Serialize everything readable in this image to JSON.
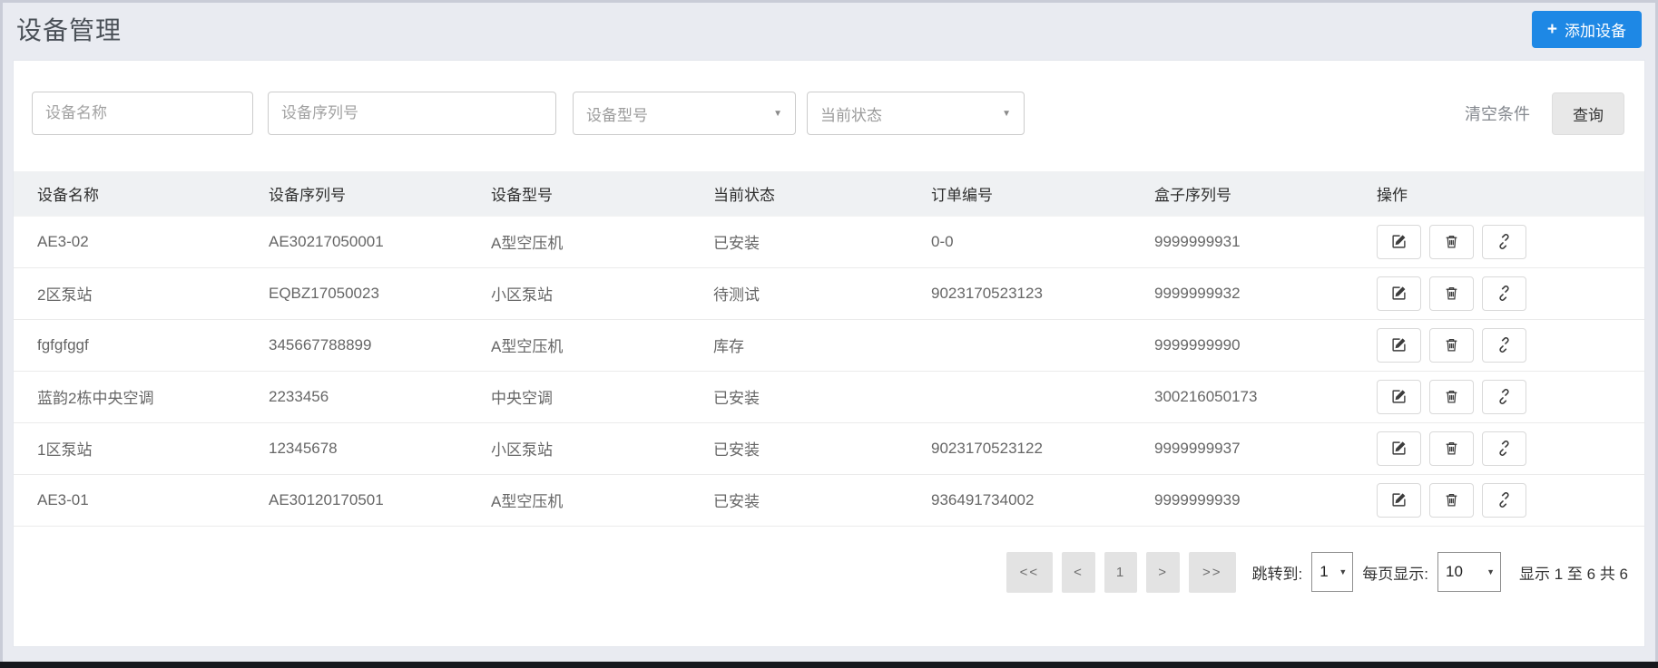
{
  "page": {
    "title": "设备管理"
  },
  "header": {
    "add_button": {
      "plus": "+",
      "label": "添加设备",
      "color": "#1e88e5"
    }
  },
  "filters": {
    "device_name_placeholder": "设备名称",
    "serial_placeholder": "设备序列号",
    "model_selected": "设备型号",
    "status_selected": "当前状态",
    "caret": "▼",
    "clear_label": "清空条件",
    "search_label": "查询"
  },
  "table": {
    "columns": {
      "name": "设备名称",
      "serial": "设备序列号",
      "model": "设备型号",
      "status": "当前状态",
      "order": "订单编号",
      "box": "盒子序列号",
      "actions": "操作"
    },
    "action_icons": [
      "edit-icon",
      "trash-icon",
      "unlink-icon"
    ],
    "rows": [
      {
        "name": "AE3-02",
        "serial": "AE30217050001",
        "model": "A型空压机",
        "status": "已安装",
        "order": "0-0",
        "box": "9999999931"
      },
      {
        "name": "2区泵站",
        "serial": "EQBZ17050023",
        "model": "小区泵站",
        "status": "待测试",
        "order": "9023170523123",
        "box": "9999999932"
      },
      {
        "name": "fgfgfggf",
        "serial": "345667788899",
        "model": "A型空压机",
        "status": "库存",
        "order": "",
        "box": "9999999990"
      },
      {
        "name": "蓝韵2栋中央空调",
        "serial": "2233456",
        "model": "中央空调",
        "status": "已安装",
        "order": "",
        "box": "300216050173"
      },
      {
        "name": "1区泵站",
        "serial": "12345678",
        "model": "小区泵站",
        "status": "已安装",
        "order": "9023170523122",
        "box": "9999999937"
      },
      {
        "name": "AE3-01",
        "serial": "AE30120170501",
        "model": "A型空压机",
        "status": "已安装",
        "order": "936491734002",
        "box": "9999999939"
      }
    ]
  },
  "pagination": {
    "first": "<<",
    "prev": "<",
    "page": "1",
    "next": ">",
    "last": ">>",
    "jump_label": "跳转到:",
    "jump_value": "1",
    "per_page_label": "每页显示:",
    "per_page_value": "10",
    "caret": "▼",
    "summary": "显示 1 至 6 共 6"
  }
}
